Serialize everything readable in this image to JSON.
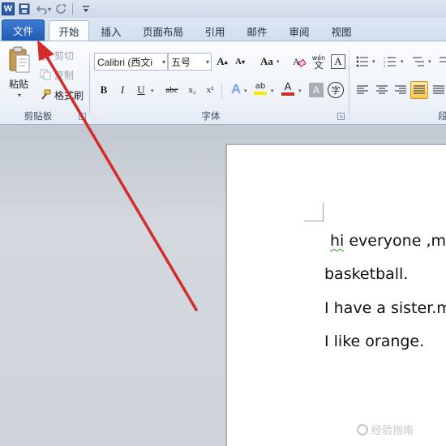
{
  "app": {
    "logo_letter": "W"
  },
  "quick_access": {
    "items": [
      "save-icon",
      "undo-icon",
      "redo-icon",
      "customize-icon"
    ]
  },
  "tabs": [
    {
      "id": "file",
      "label": "文件"
    },
    {
      "id": "home",
      "label": "开始"
    },
    {
      "id": "insert",
      "label": "插入"
    },
    {
      "id": "layout",
      "label": "页面布局"
    },
    {
      "id": "references",
      "label": "引用"
    },
    {
      "id": "mailings",
      "label": "邮件"
    },
    {
      "id": "review",
      "label": "审阅"
    },
    {
      "id": "view",
      "label": "视图"
    }
  ],
  "active_tab": "开始",
  "ribbon": {
    "clipboard": {
      "paste_label": "粘贴",
      "cut_label": "剪切",
      "copy_label": "复制",
      "format_painter_label": "格式刷",
      "group_label": "剪贴板"
    },
    "font": {
      "font_name": "Calibri (西文i",
      "font_size": "五号",
      "grow_font": "A",
      "shrink_font": "A",
      "change_case": "Aa",
      "clear_format_glyph": "A",
      "phonetic_glyph": "wén",
      "char_border_glyph": "A",
      "bold": "B",
      "italic": "I",
      "underline": "U",
      "strikethrough": "abc",
      "subscript": "x₂",
      "superscript": "x²",
      "text_effects": "A",
      "highlight": "ab",
      "font_color": "A",
      "char_shading": "A",
      "enclose_char": "字",
      "group_label": "字体"
    },
    "paragraph": {
      "group_label_partial": "段"
    }
  },
  "document": {
    "lines": [
      {
        "pre": "hi",
        "post": " everyone ,m"
      },
      {
        "text": "basketball."
      },
      {
        "text": "I have a sister.m"
      },
      {
        "text": "I like orange."
      }
    ]
  },
  "watermark": {
    "text": "经验指南"
  },
  "colors": {
    "file_tab": "#1f5bb5",
    "annotation_arrow": "#d42a2a",
    "font_color_bar": "#d42a2a",
    "highlight_bar": "#ffe600"
  }
}
